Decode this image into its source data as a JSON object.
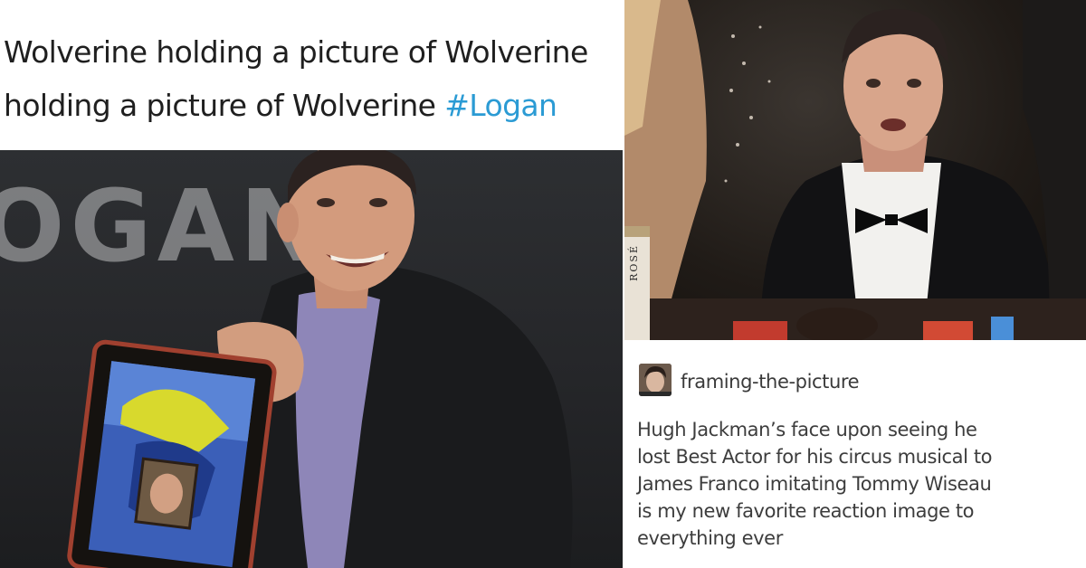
{
  "tweet": {
    "line1": "Wolverine holding a picture of Wolverine",
    "line2_text": "holding a picture of Wolverine ",
    "hashtag": "#Logan"
  },
  "left_photo": {
    "backdrop_text": "OGAN"
  },
  "right_photo": {
    "bottle_label": "ROSÉ"
  },
  "post": {
    "username": "framing-the-picture",
    "lines": [
      "Hugh Jackman’s face upon seeing he",
      "lost Best Actor for his circus musical to",
      "James Franco imitating Tommy Wiseau",
      "is my new favorite reaction image to",
      "everything ever"
    ]
  },
  "colors": {
    "hashtag": "#2b9bd4",
    "text": "#1f1f1f",
    "post_text": "#3d3d3d"
  }
}
